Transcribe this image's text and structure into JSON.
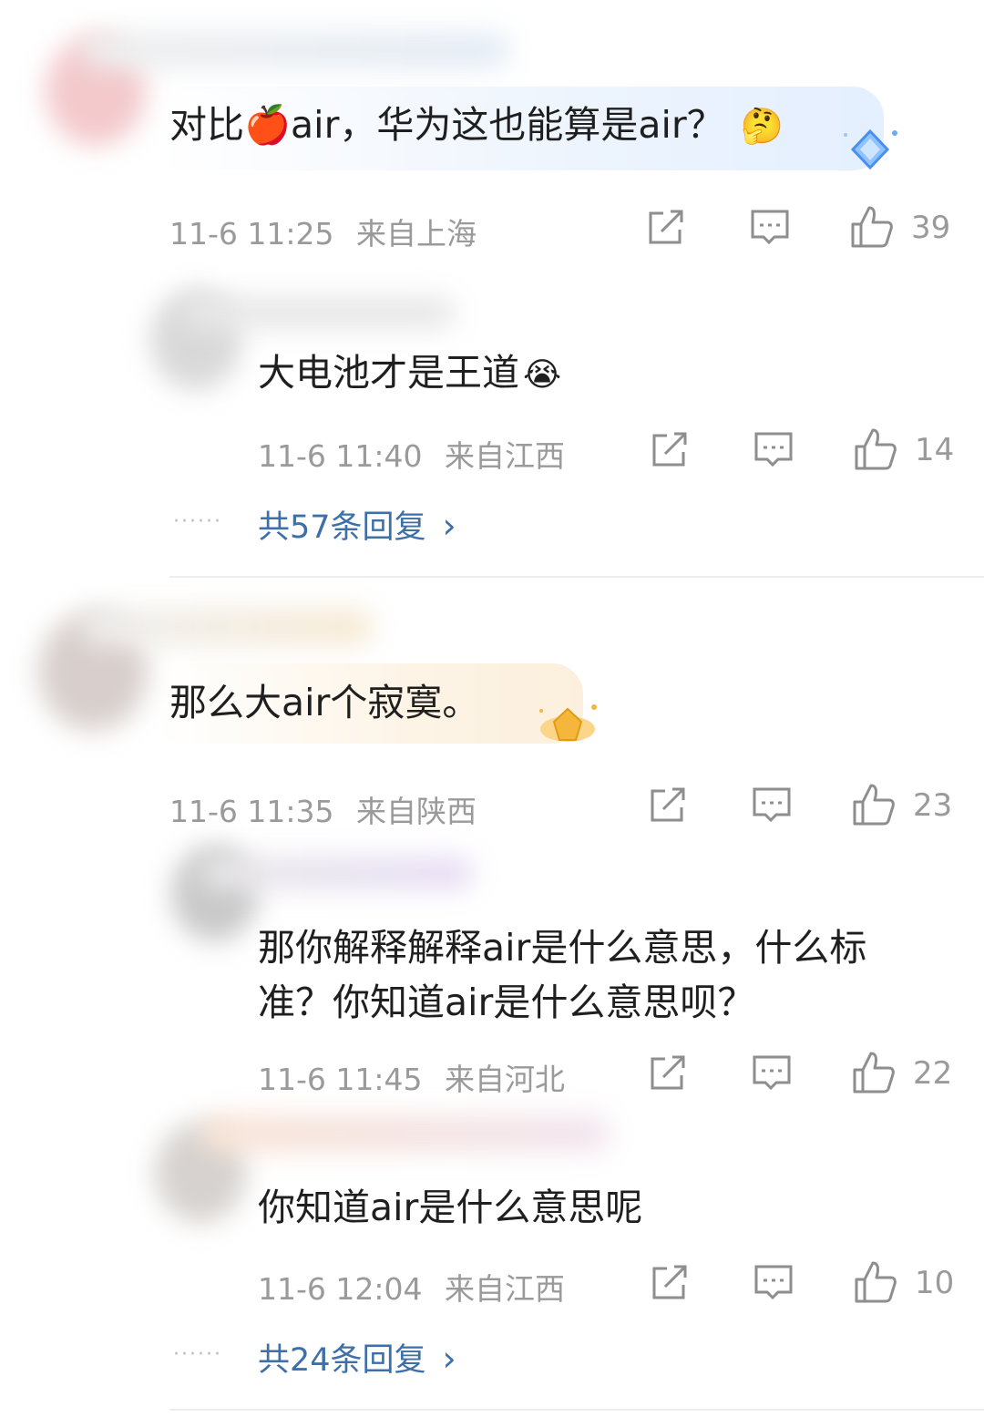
{
  "comments": [
    {
      "text": "对比🍎air，华为这也能算是air？",
      "emoji": "🤔",
      "time": "11-6 11:25",
      "location": "来自上海",
      "likes": "39",
      "badge_color": "#6fa9f2",
      "replies": [
        {
          "text": "大电池才是王道",
          "emoji": "😭",
          "time": "11-6 11:40",
          "location": "来自江西",
          "likes": "14"
        }
      ],
      "more_replies": "共57条回复",
      "more_chevron": "›"
    },
    {
      "text": "那么大air个寂寞。",
      "time": "11-6 11:35",
      "location": "来自陕西",
      "likes": "23",
      "badge_color": "#f5b73b",
      "replies": [
        {
          "text_line1": "那你解释解释air是什么意思，什么标",
          "text_line2": "准？你知道air是什么意思呗？",
          "time": "11-6 11:45",
          "location": "来自河北",
          "likes": "22"
        },
        {
          "text": "你知道air是什么意思呢",
          "time": "11-6 12:04",
          "location": "来自江西",
          "likes": "10"
        }
      ],
      "more_replies": "共24条回复",
      "more_chevron": "›"
    }
  ],
  "more_dots": "······",
  "icons": [
    "share-icon",
    "comment-icon",
    "like-icon"
  ]
}
